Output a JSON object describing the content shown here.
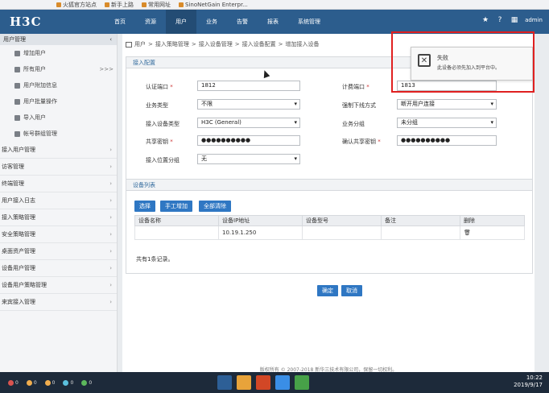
{
  "browser": {
    "bookmarks": [
      "火狐官方站点",
      "新手上路",
      "常用网址",
      "SinoNetGain Enterpr..."
    ]
  },
  "topnav": {
    "logo": "H3C",
    "items": [
      "首页",
      "资源",
      "用户",
      "业务",
      "告警",
      "报表",
      "系统管理"
    ],
    "active_index": 2,
    "user": "admin"
  },
  "sidebar": {
    "header": "用户管理",
    "subitems": [
      {
        "label": "增加用户",
        "icon": "user-add-icon"
      },
      {
        "label": "所有用户",
        "icon": "users-icon",
        "expand": ">>>"
      },
      {
        "label": "用户附加信息",
        "icon": "info-icon"
      },
      {
        "label": "用户批量操作",
        "icon": "batch-icon"
      },
      {
        "label": "导入用户",
        "icon": "import-icon"
      },
      {
        "label": "帐号群组管理",
        "icon": "group-icon"
      }
    ],
    "groups": [
      "接入用户管理",
      "访客管理",
      "终端管理",
      "用户接入日志",
      "接入策略管理",
      "安全策略管理",
      "桌面资产管理",
      "设备用户管理",
      "设备用户策略管理",
      "来宾接入管理"
    ]
  },
  "breadcrumb": [
    "用户",
    "接入策略管理",
    "接入设备管理",
    "接入设备配置",
    "增加接入设备"
  ],
  "config": {
    "title": "接入配置",
    "fields": {
      "auth_port_label": "认证端口",
      "auth_port_value": "1812",
      "acct_port_label": "计费端口",
      "acct_port_value": "1813",
      "service_type_label": "业务类型",
      "service_type_value": "不限",
      "force_offline_label": "强制下线方式",
      "force_offline_value": "断开用户连接",
      "device_type_label": "接入设备类型",
      "device_type_value": "H3C (General)",
      "service_group_label": "业务分组",
      "service_group_value": "未分组",
      "shared_key_label": "共享密钥",
      "shared_key_value": "●●●●●●●●●●",
      "confirm_key_label": "确认共享密钥",
      "confirm_key_value": "●●●●●●●●●●",
      "location_group_label": "接入位置分组",
      "location_group_value": "无"
    }
  },
  "devices": {
    "title": "设备列表",
    "buttons": [
      "选择",
      "手工增加",
      "全部清除"
    ],
    "columns": [
      "设备名称",
      "设备IP地址",
      "设备型号",
      "备注",
      "删除"
    ],
    "rows": [
      {
        "name": "",
        "ip": "10.19.1.250",
        "model": "",
        "note": ""
      }
    ],
    "total": "共有1条记录。"
  },
  "actions": {
    "ok": "确定",
    "cancel": "取消"
  },
  "footer": "版权所有 © 2007-2018 新华三技术有限公司，保留一切权利。",
  "toast": {
    "title": "失败",
    "message": "此设备必须先加入到平台中。"
  },
  "taskbar": {
    "stats": [
      {
        "value": "0",
        "color": "#d9534f"
      },
      {
        "value": "0",
        "color": "#f0ad4e"
      },
      {
        "value": "0",
        "color": "#f0ad4e"
      },
      {
        "value": "0",
        "color": "#5bc0de"
      },
      {
        "value": "0",
        "color": "#5cb85c"
      }
    ],
    "time": "10:22",
    "date": "2019/9/17"
  }
}
